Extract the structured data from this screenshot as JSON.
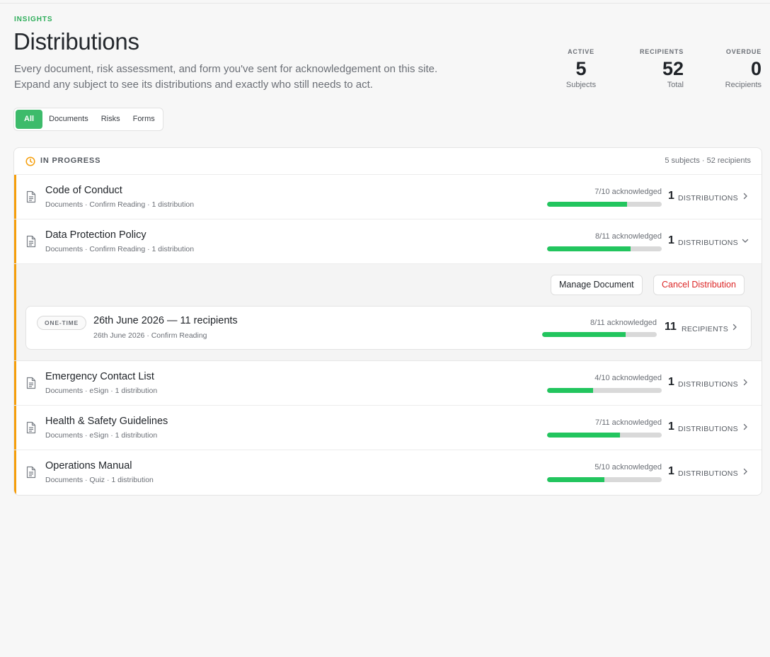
{
  "header": {
    "eyebrow": "INSIGHTS",
    "title": "Distributions",
    "description_line1": "Every document, risk assessment, and form you've sent for acknowledgement on this site.",
    "description_line2": "Expand any subject to see its distributions and exactly who still needs to act."
  },
  "stats": [
    {
      "label": "ACTIVE",
      "value": "5",
      "sub": "Subjects"
    },
    {
      "label": "RECIPIENTS",
      "value": "52",
      "sub": "Total"
    },
    {
      "label": "OVERDUE",
      "value": "0",
      "sub": "Recipients"
    }
  ],
  "filters": [
    "All",
    "Documents",
    "Risks",
    "Forms"
  ],
  "active_filter": "All",
  "group": {
    "title": "IN PROGRESS",
    "meta": "5 subjects · 52 recipients",
    "accent_color": "#f59e0b"
  },
  "subjects": [
    {
      "name": "Code of Conduct",
      "sub": "Documents · Confirm Reading · 1 distribution",
      "ack": "7/10 acknowledged",
      "progress": 0.7,
      "count": "1",
      "count_label": "DISTRIBUTIONS",
      "expanded": false
    },
    {
      "name": "Data Protection Policy",
      "sub": "Documents · Confirm Reading · 1 distribution",
      "ack": "8/11 acknowledged",
      "progress": 0.727,
      "count": "1",
      "count_label": "DISTRIBUTIONS",
      "expanded": true
    },
    {
      "name": "Emergency Contact List",
      "sub": "Documents · eSign · 1 distribution",
      "ack": "4/10 acknowledged",
      "progress": 0.4,
      "count": "1",
      "count_label": "DISTRIBUTIONS",
      "expanded": false
    },
    {
      "name": "Health & Safety Guidelines",
      "sub": "Documents · eSign · 1 distribution",
      "ack": "7/11 acknowledged",
      "progress": 0.636,
      "count": "1",
      "count_label": "DISTRIBUTIONS",
      "expanded": false
    },
    {
      "name": "Operations Manual",
      "sub": "Documents · Quiz · 1 distribution",
      "ack": "5/10 acknowledged",
      "progress": 0.5,
      "count": "1",
      "count_label": "DISTRIBUTIONS",
      "expanded": false
    }
  ],
  "expanded_panel": {
    "manage_label": "Manage Document",
    "cancel_label": "Cancel Distribution",
    "distribution": {
      "badge": "ONE-TIME",
      "title": "26th June 2026 — 11 recipients",
      "sub": "26th June 2026 · Confirm Reading",
      "ack": "8/11 acknowledged",
      "progress": 0.727,
      "count": "11",
      "count_label": "RECIPIENTS"
    }
  },
  "colors": {
    "brand_green": "#3dbb6b",
    "progress_fill": "#22c55e",
    "danger": "#dc2626"
  }
}
